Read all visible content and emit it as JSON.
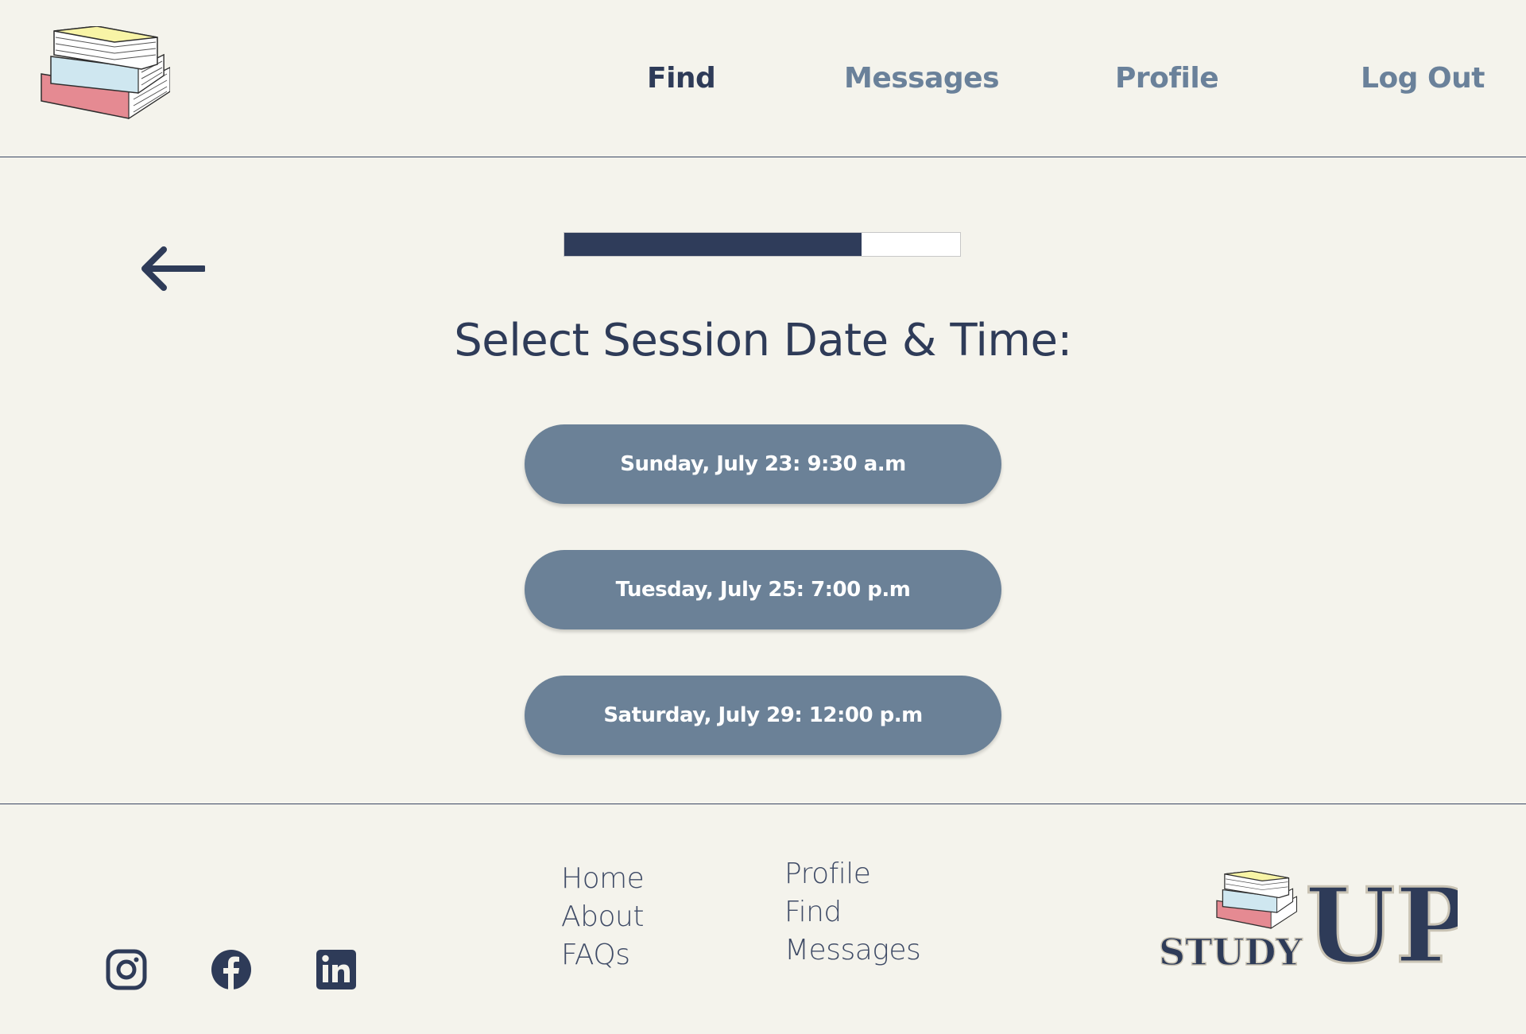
{
  "header": {
    "nav": [
      {
        "label": "Find",
        "active": true
      },
      {
        "label": "Messages",
        "active": false
      },
      {
        "label": "Profile",
        "active": false
      },
      {
        "label": "Log Out",
        "active": false
      }
    ]
  },
  "main": {
    "progress": 0.75,
    "title": "Select Session Date & Time:",
    "slots": [
      "Sunday, July 23: 9:30 a.m",
      "Tuesday, July 25: 7:00 p.m",
      "Saturday, July 29: 12:00 p.m"
    ]
  },
  "footer": {
    "links_col1": [
      "Home",
      "About",
      "FAQs"
    ],
    "links_col2": [
      "Profile",
      "Find",
      "Messages"
    ],
    "brand": {
      "word1": "STUDY",
      "word2": "UP"
    },
    "social": [
      "instagram-icon",
      "facebook-icon",
      "linkedin-icon"
    ]
  },
  "colors": {
    "background": "#f4f3ec",
    "navy": "#2e3b58",
    "slate": "#6b8197",
    "book_yellow": "#f8f4a6",
    "book_blue": "#cfe7f0",
    "book_pink": "#e58a92"
  }
}
